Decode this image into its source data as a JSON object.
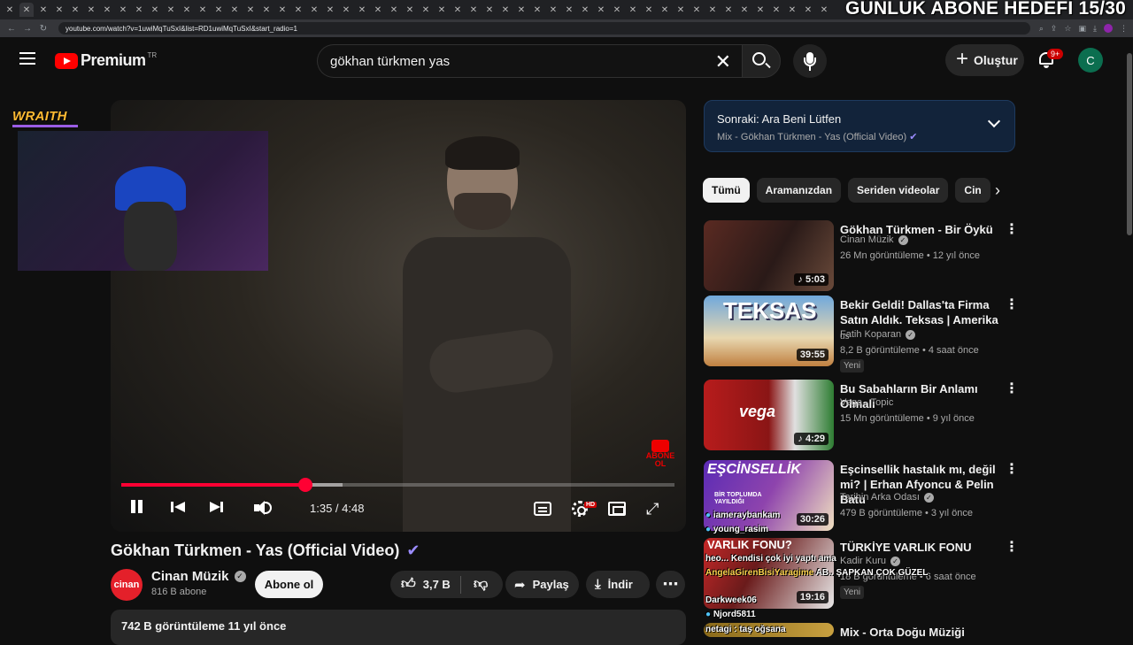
{
  "overlay": {
    "goal": "GÜNLÜK ABONE HEDEFİ 15/30",
    "streamer_brand": "WRAITH"
  },
  "browser": {
    "url": "youtube.com/watch?v=1uwiMqTuSxI&list=RD1uwiMqTuSxI&start_radio=1",
    "tab_close": "✕"
  },
  "masthead": {
    "logo_text": "Premium",
    "logo_country": "TR",
    "search_value": "gökhan türkmen yas",
    "create_label": "Oluştur",
    "notif_badge": "9+",
    "avatar_initial": "C"
  },
  "player": {
    "current_time": "1:35",
    "duration": "4:48",
    "time_display": "1:35 / 4:48",
    "progress": 0.333,
    "buffered": 0.4,
    "hd_badge": "HD",
    "abone_ol_badge": "ABONE OL"
  },
  "video": {
    "title": "Gökhan Türkmen - Yas (Official Video)",
    "channel": "Cinan Müzik",
    "channel_logo": "cinan",
    "subscribers": "816 B abone",
    "subscribe_label": "Abone ol",
    "likes": "3,7 B",
    "share_label": "Paylaş",
    "download_label": "İndir",
    "views_date": "742 B görüntüleme  11 yıl önce"
  },
  "up_next": {
    "title": "Sonraki: Ara Beni Lütfen",
    "subtitle": "Mix - Gökhan Türkmen - Yas (Official Video)"
  },
  "chips": [
    "Tümü",
    "Aramanızdan",
    "Seriden videolar",
    "Cin"
  ],
  "recommendations": [
    {
      "title": "Gökhan Türkmen - Bir Öykü",
      "channel": "Cinan Müzik",
      "verified": true,
      "meta": "26 Mn görüntüleme • 12 yıl önce",
      "duration": "5:03",
      "is_new": false
    },
    {
      "title": "Bekir Geldi! Dallas'ta Firma Satın Aldık. Teksas | Amerika",
      "title_tag": "us",
      "channel": "Fatih Koparan",
      "verified": true,
      "meta": "8,2 B görüntüleme • 4 saat önce",
      "duration": "39:55",
      "is_new": true,
      "thumb_text": "TEKSAS"
    },
    {
      "title": "Bu Sabahların Bir Anlamı Olmalı",
      "channel": "Vega - Topic",
      "verified": false,
      "meta": "15 Mn görüntüleme • 9 yıl önce",
      "duration": "4:29",
      "is_new": false,
      "thumb_text": "vega"
    },
    {
      "title": "Eşcinsellik hastalık mı, değil mi? | Erhan Afyoncu & Pelin Batu",
      "channel": "Tarihin Arka Odası",
      "verified": true,
      "meta": "479 B görüntüleme • 3 yıl önce",
      "duration": "30:26",
      "is_new": false,
      "thumb_text": "EŞCİNSELLİK",
      "thumb_sub": "BİR TOPLUMDA YAYILDIĞI"
    },
    {
      "title": "TÜRKİYE VARLIK FONU",
      "channel": "Kadir Kuru",
      "verified": true,
      "meta": "18 B görüntüleme • 6 saat önce",
      "duration": "19:16",
      "is_new": true,
      "thumb_text": "VARLIK FONU?"
    },
    {
      "title": "Mix - Orta Doğu Müziği",
      "channel": "",
      "verified": false,
      "meta": "",
      "duration": "",
      "is_new": false
    }
  ],
  "new_label": "Yeni",
  "chat": [
    {
      "user": "iameraybankam",
      "text": ""
    },
    {
      "user": "young_rasim",
      "text": ""
    },
    {
      "user": "heo...",
      "text": "Kendisi çok iyi yaptı ama"
    },
    {
      "user": "AngelaGirenBisiYaragime",
      "text": "AB.. ŞAPKAN ÇOK GÜZEL"
    },
    {
      "user": "Darkweek06",
      "text": ""
    },
    {
      "user": "Njord5811",
      "text": ""
    },
    {
      "user": "netagi",
      "text": "taş oğsana"
    }
  ]
}
